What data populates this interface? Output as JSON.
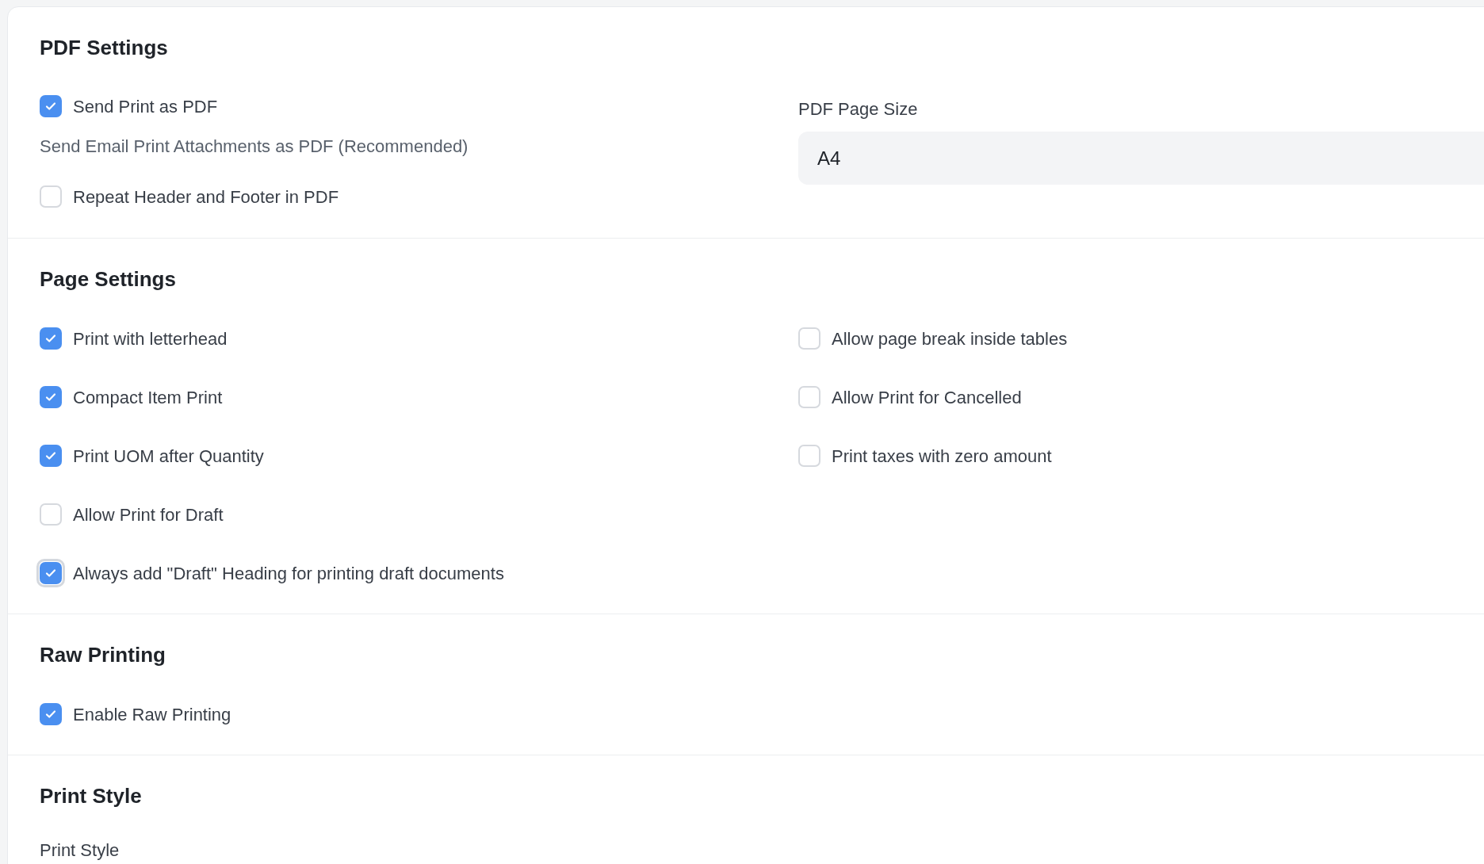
{
  "sections": [
    {
      "title": "PDF Settings",
      "kind": "pdf",
      "left": [
        {
          "kind": "checkbox",
          "label": "Send Print as PDF",
          "checked": true,
          "focused": false
        },
        {
          "kind": "description",
          "text": "Send Email Print Attachments as PDF (Recommended)"
        },
        {
          "kind": "checkbox",
          "label": "Repeat Header and Footer in PDF",
          "checked": false,
          "focused": false
        }
      ],
      "right": [
        {
          "kind": "select",
          "label": "PDF Page Size",
          "value": "A4"
        }
      ]
    },
    {
      "title": "Page Settings",
      "kind": "grid",
      "left": [
        {
          "kind": "checkbox",
          "label": "Print with letterhead",
          "checked": true,
          "focused": false
        },
        {
          "kind": "checkbox",
          "label": "Compact Item Print",
          "checked": true,
          "focused": false
        },
        {
          "kind": "checkbox",
          "label": "Print UOM after Quantity",
          "checked": true,
          "focused": false
        },
        {
          "kind": "checkbox",
          "label": "Allow Print for Draft",
          "checked": false,
          "focused": false
        },
        {
          "kind": "checkbox",
          "label": "Always add \"Draft\" Heading for printing draft documents",
          "checked": true,
          "focused": true
        }
      ],
      "right": [
        {
          "kind": "checkbox",
          "label": "Allow page break inside tables",
          "checked": false,
          "focused": false
        },
        {
          "kind": "checkbox",
          "label": "Allow Print for Cancelled",
          "checked": false,
          "focused": false
        },
        {
          "kind": "checkbox",
          "label": "Print taxes with zero amount",
          "checked": false,
          "focused": false
        }
      ]
    },
    {
      "title": "Raw Printing",
      "kind": "grid",
      "left": [
        {
          "kind": "checkbox",
          "label": "Enable Raw Printing",
          "checked": true,
          "focused": false
        }
      ]
    },
    {
      "title": "Print Style",
      "kind": "tail",
      "field_label": "Print Style"
    }
  ]
}
